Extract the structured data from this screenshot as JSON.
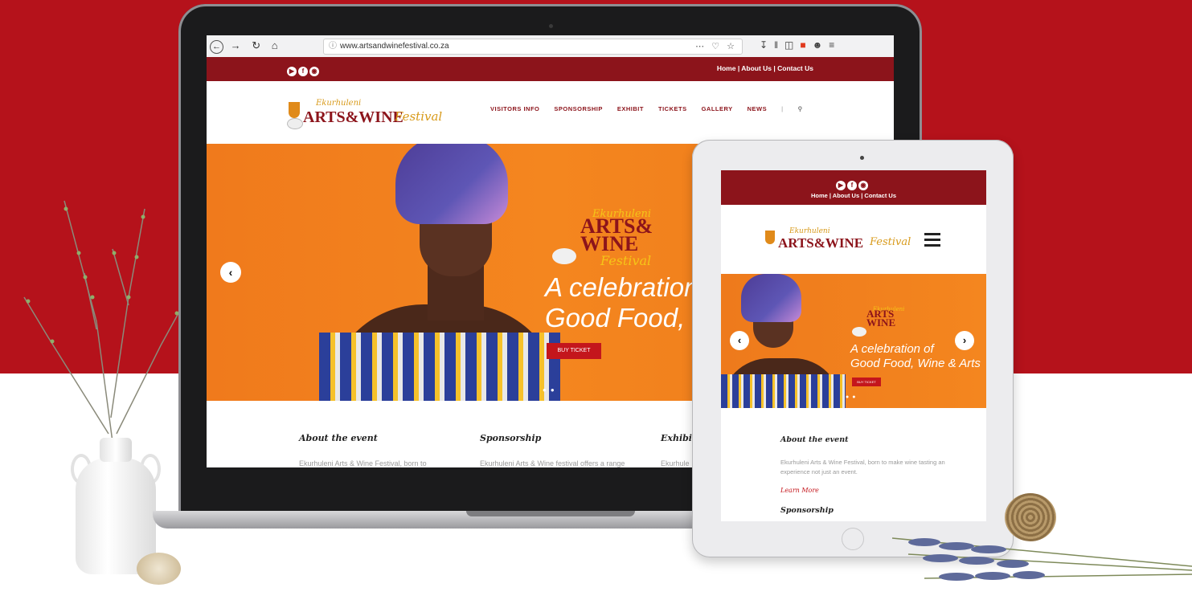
{
  "browser": {
    "url": "www.artsandwinefestival.co.za",
    "url_actions": "⋯ ♡ ☆"
  },
  "site": {
    "top_links": "Home | About Us | Contact Us",
    "logo": {
      "script": "Ekurhuleni",
      "main": "ARTS&WINE",
      "festival": "Festival"
    },
    "nav": {
      "items": [
        "VISITORS INFO",
        "SPONSORSHIP",
        "EXHIBIT",
        "TICKETS",
        "GALLERY",
        "NEWS"
      ],
      "separator": "|"
    },
    "hero": {
      "tagline_line1": "A celebration o",
      "tagline_line2": "Good Food, W",
      "button": "BUY TICKET",
      "logo_arts": "ARTS&",
      "logo_wine": "WINE"
    },
    "sections": [
      {
        "title": "About the event",
        "text": "Ekurhuleni Arts & Wine Festival, born to"
      },
      {
        "title": "Sponsorship",
        "text": "Ekurhuleni Arts & Wine festival offers a range"
      },
      {
        "title": "Exhibi",
        "text": "Ekurhule"
      }
    ]
  },
  "tablet": {
    "top_links": "Home | About Us | Contact Us",
    "hero": {
      "tagline_line1": "A celebration of",
      "tagline_line2": "Good Food, Wine & Arts",
      "button": "BUY TICKET",
      "logo_arts": "ARTS",
      "logo_wine": "WINE",
      "logo_festival": "Festival"
    },
    "about": {
      "title": "About the event",
      "text": "Ekurhuleni Arts & Wine Festival, born to make wine tasting an experience not just an event.",
      "link": "Learn More"
    },
    "sponsorship_title": "Sponsorship"
  },
  "colors": {
    "brand_red": "#8c141b",
    "background_red": "#b5121b",
    "hero_orange": "#f4861f",
    "button_red": "#c4161c"
  }
}
